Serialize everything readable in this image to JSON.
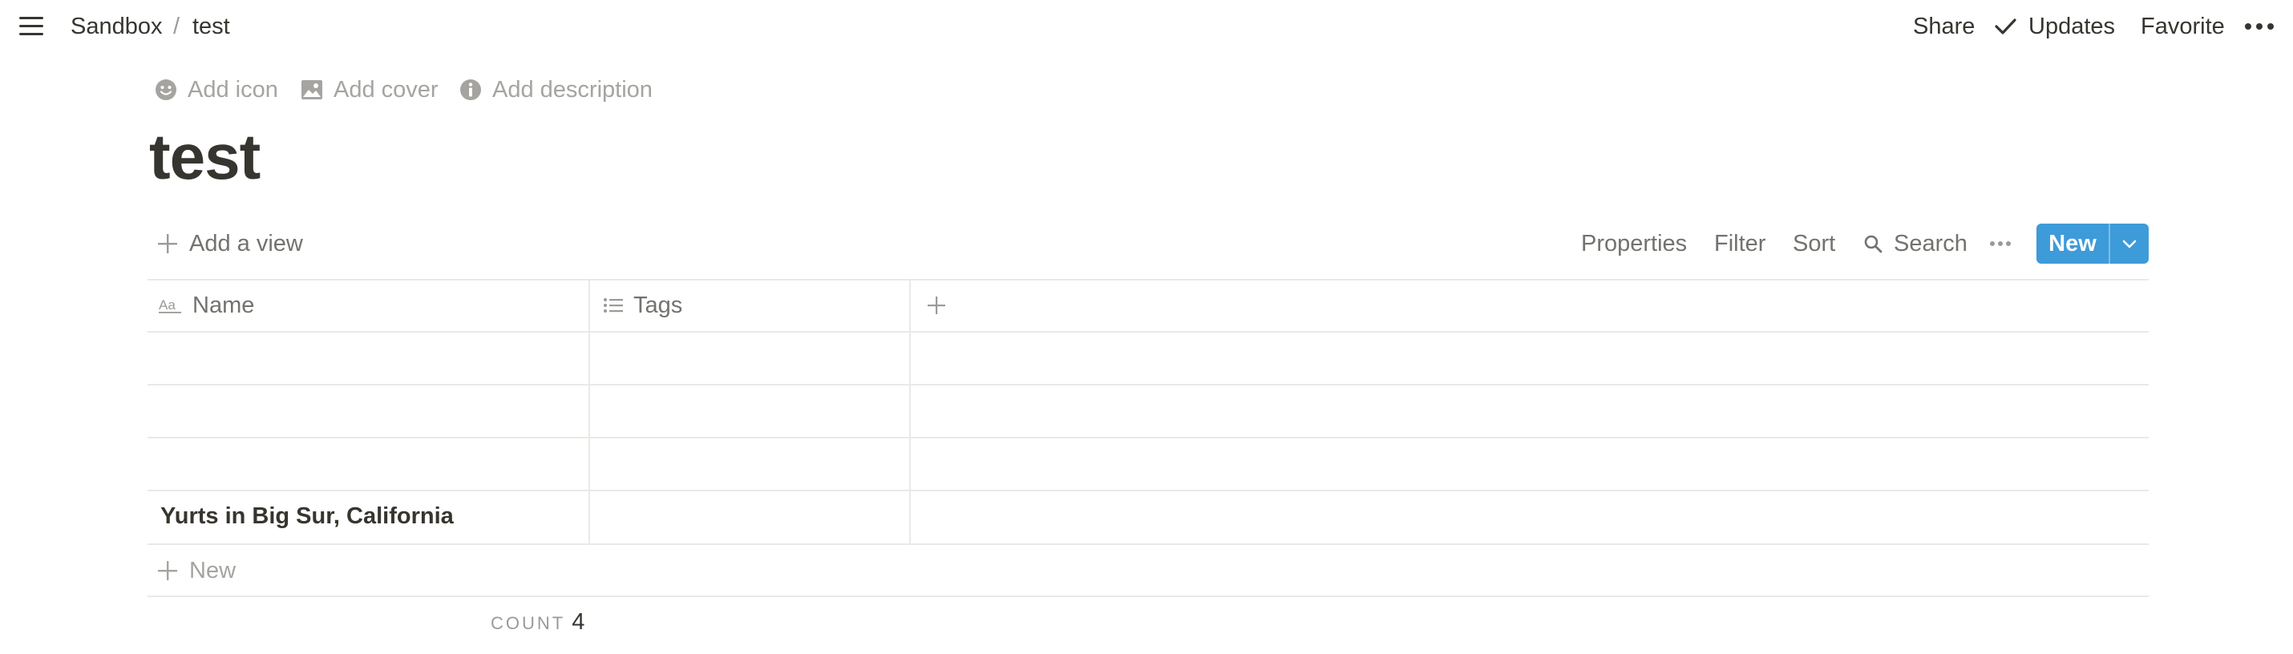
{
  "topbar": {
    "breadcrumb": [
      {
        "label": "Sandbox"
      },
      {
        "label": "test"
      }
    ],
    "separator": "/",
    "share_label": "Share",
    "updates_label": "Updates",
    "favorite_label": "Favorite",
    "icons": {
      "menu": "hamburger-menu-icon",
      "updates": "check-icon",
      "more": "more-horizontal-icon"
    }
  },
  "page": {
    "add_icon_label": "Add icon",
    "add_cover_label": "Add cover",
    "add_description_label": "Add description",
    "title": "test"
  },
  "view_toolbar": {
    "add_view_label": "Add a view",
    "properties_label": "Properties",
    "filter_label": "Filter",
    "sort_label": "Sort",
    "search_label": "Search",
    "new_label": "New",
    "accent_color": "#3d9bd9"
  },
  "table": {
    "columns": [
      {
        "label": "Name",
        "icon": "text-property-icon"
      },
      {
        "label": "Tags",
        "icon": "list-property-icon"
      }
    ],
    "rows": [
      {
        "name": "",
        "tags": ""
      },
      {
        "name": "",
        "tags": ""
      },
      {
        "name": "",
        "tags": ""
      },
      {
        "name": "Yurts in Big Sur, California",
        "tags": ""
      }
    ],
    "new_row_label": "New",
    "count_label": "COUNT",
    "count_value": "4"
  }
}
